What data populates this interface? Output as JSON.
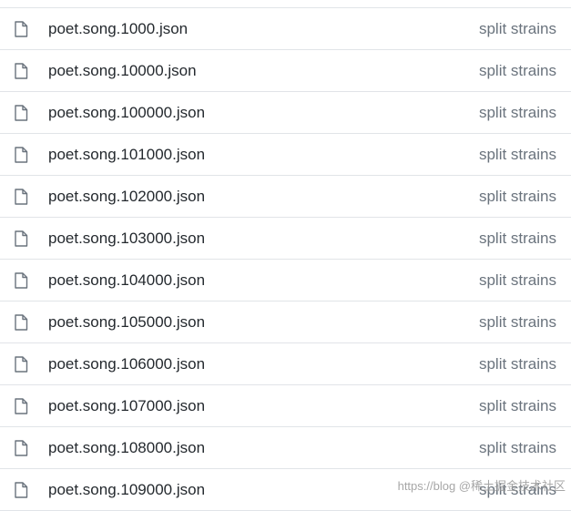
{
  "files": [
    {
      "icon": "file-icon",
      "name": "poet.song.1000.json",
      "message": "split strains"
    },
    {
      "icon": "file-icon",
      "name": "poet.song.10000.json",
      "message": "split strains"
    },
    {
      "icon": "file-icon",
      "name": "poet.song.100000.json",
      "message": "split strains"
    },
    {
      "icon": "file-icon",
      "name": "poet.song.101000.json",
      "message": "split strains"
    },
    {
      "icon": "file-icon",
      "name": "poet.song.102000.json",
      "message": "split strains"
    },
    {
      "icon": "file-icon",
      "name": "poet.song.103000.json",
      "message": "split strains"
    },
    {
      "icon": "file-icon",
      "name": "poet.song.104000.json",
      "message": "split strains"
    },
    {
      "icon": "file-icon",
      "name": "poet.song.105000.json",
      "message": "split strains"
    },
    {
      "icon": "file-icon",
      "name": "poet.song.106000.json",
      "message": "split strains"
    },
    {
      "icon": "file-icon",
      "name": "poet.song.107000.json",
      "message": "split strains"
    },
    {
      "icon": "file-icon",
      "name": "poet.song.108000.json",
      "message": "split strains"
    },
    {
      "icon": "file-icon",
      "name": "poet.song.109000.json",
      "message": "split strains"
    }
  ],
  "watermark": "https://blog  @稀土掘金技术社区"
}
